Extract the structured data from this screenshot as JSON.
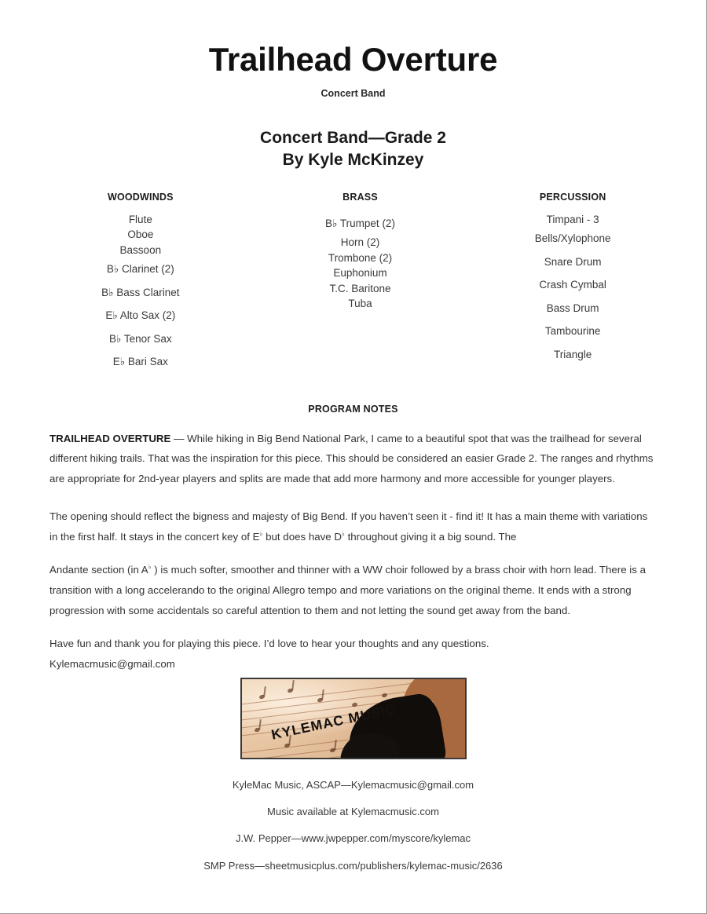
{
  "document": {
    "title": "Trailhead Overture",
    "subtitle": "Concert Band",
    "grade_line": "Concert Band—Grade 2",
    "composer_line": "By Kyle McKinzey"
  },
  "instrumentation": {
    "woodwinds": {
      "heading": "WOODWINDS",
      "items": [
        {
          "label": "Flute",
          "spacing": "tight"
        },
        {
          "label": "Oboe",
          "spacing": "tight"
        },
        {
          "label": "Bassoon",
          "spacing": "tight"
        },
        {
          "label": "B♭ Clarinet (2)",
          "spacing": "loose"
        },
        {
          "label": "B♭ Bass Clarinet",
          "spacing": "loose"
        },
        {
          "label": "E♭ Alto Sax (2)",
          "spacing": "loose"
        },
        {
          "label": "B♭ Tenor Sax",
          "spacing": "loose"
        },
        {
          "label": "E♭ Bari Sax",
          "spacing": "loose"
        }
      ]
    },
    "brass": {
      "heading": "BRASS",
      "items": [
        {
          "label": "B♭ Trumpet (2)",
          "spacing": "loose"
        },
        {
          "label": "Horn (2)",
          "spacing": "tight"
        },
        {
          "label": "Trombone (2)",
          "spacing": "tight"
        },
        {
          "label": "Euphonium",
          "spacing": "tight"
        },
        {
          "label": "T.C. Baritone",
          "spacing": "tight"
        },
        {
          "label": "Tuba",
          "spacing": "tight"
        }
      ]
    },
    "percussion": {
      "heading": "PERCUSSION",
      "items": [
        {
          "label": "Timpani - 3",
          "spacing": "tight"
        },
        {
          "label": "Bells/Xylophone",
          "spacing": "loose"
        },
        {
          "label": "Snare Drum",
          "spacing": "loose"
        },
        {
          "label": "Crash Cymbal",
          "spacing": "loose"
        },
        {
          "label": "Bass Drum",
          "spacing": "loose"
        },
        {
          "label": "Tambourine",
          "spacing": "loose"
        },
        {
          "label": "Triangle",
          "spacing": "loose"
        }
      ]
    }
  },
  "program_notes": {
    "heading": "PROGRAM NOTES",
    "para1_lead": "TRAILHEAD OVERTURE",
    "para1_rest": " — While hiking in Big Bend National Park, I came to a beautiful spot that was the trailhead for several different hiking trails. That was the inspiration for this piece. This should be considered an easier Grade 2. The ranges and rhythms are appropriate for 2nd-year players and splits are made that add more harmony and more accessible for younger players.",
    "para2_a": "The opening should reflect the bigness and majesty of Big Bend. If you haven’t seen it  - find it! It has a main theme with variations in the first half. It stays in the concert key of E",
    "para2_flat1": "♭",
    "para2_b": " but does have D",
    "para2_flat2": "♭",
    "para2_c": " throughout giving it a big sound. The",
    "para3_a": "Andante section (in A",
    "para3_flat": "♭",
    "para3_b": " ) is much softer, smoother and thinner with a WW choir followed by a brass choir with horn lead. There is a transition with a long accelerando to the original Allegro tempo and more variations on the original theme. It ends with a strong progression with some accidentals so careful attention to them and not letting the sound get away from the band.",
    "para4": "Have fun and thank you for playing this piece. I’d love to hear your thoughts and any questions.",
    "email": "Kylemacmusic@gmail.com"
  },
  "logo": {
    "text": "KYLEMAC MUSIC",
    "paper_color": "#e9c9a6",
    "brown_color": "#a9693f",
    "ink_color": "#100d0b"
  },
  "footer": {
    "lines": [
      "KyleMac Music, ASCAP—Kylemacmusic@gmail.com",
      "Music available at Kylemacmusic.com",
      "J.W. Pepper—www.jwpepper.com/myscore/kylemac",
      "SMP Press—sheetmusicplus.com/publishers/kylemac-music/2636"
    ]
  }
}
